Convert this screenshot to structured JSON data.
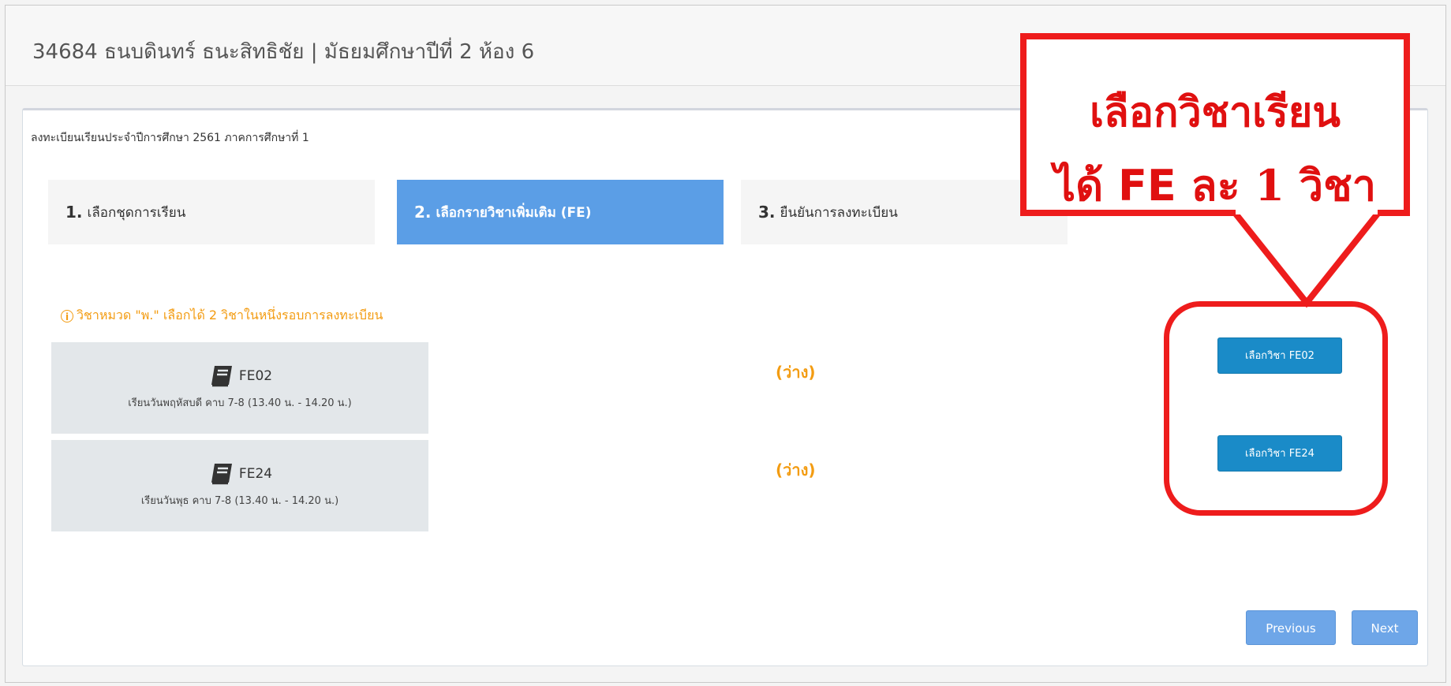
{
  "header": {
    "title": "34684  ธนบดินทร์  ธนะสิทธิชัย | มัธยมศึกษาปีที่ 2 ห้อง 6"
  },
  "panel": {
    "title": "ลงทะเบียนเรียนประจำปีการศึกษา 2561 ภาคการศึกษาที่ 1"
  },
  "steps": [
    {
      "num": "1.",
      "label": "เลือกชุดการเรียน",
      "active": false
    },
    {
      "num": "2.",
      "label": "เลือกรายวิชาเพิ่มเติม (FE)",
      "active": true
    },
    {
      "num": "3.",
      "label": "ยืนยันการลงทะเบียน",
      "active": false
    }
  ],
  "warning": {
    "icon": "info-circle-icon",
    "text": "วิชาหมวด \"พ.\" เลือกได้ 2 วิชาในหนึ่งรอบการลงทะเบียน"
  },
  "courses": [
    {
      "icon": "book-icon",
      "code": "FE02",
      "schedule": "เรียนวันพฤหัสบดี คาบ 7-8 (13.40 น. - 14.20 น.)",
      "status": "(ว่าง)",
      "button": "เลือกวิชา FE02"
    },
    {
      "icon": "book-icon",
      "code": "FE24",
      "schedule": "เรียนวันพุธ คาบ 7-8 (13.40 น. - 14.20 น.)",
      "status": "(ว่าง)",
      "button": "เลือกวิชา FE24"
    }
  ],
  "nav": {
    "previous": "Previous",
    "next": "Next"
  },
  "annotation": {
    "line1": "เลือกวิชาเรียน",
    "line2_pre": "ได้ ",
    "line2_fe": "FE",
    "line2_post": " ละ 1 วิชา",
    "color": "#ee1c1c"
  },
  "colors": {
    "active_step": "#5b9ee6",
    "select_button": "#1a8bc8",
    "nav_button": "#6ea6e8",
    "warning": "#f39c12"
  }
}
